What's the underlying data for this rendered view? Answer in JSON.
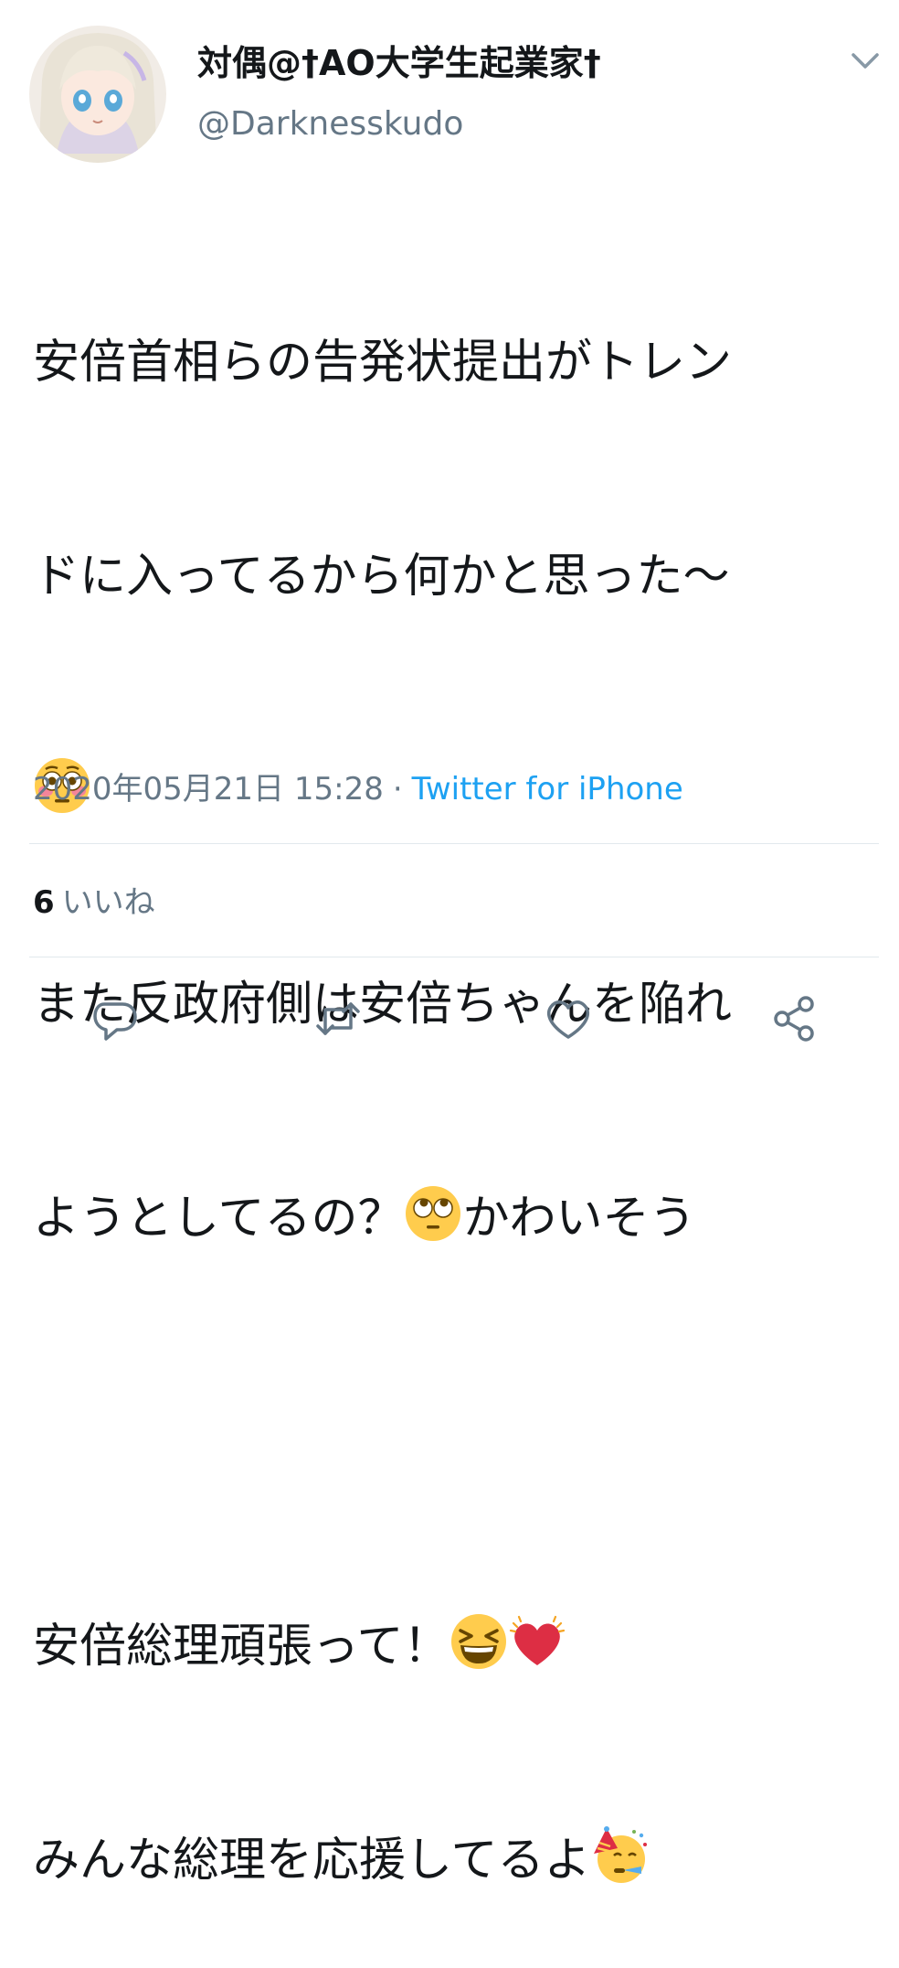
{
  "tweet": {
    "author": {
      "display_name": "対偶@†AO大学生起業家†",
      "handle": "@Darknesskudo"
    },
    "lines": [
      "安倍首相らの告発状提出がトレン",
      "ドに入ってるから何かと思った〜",
      "また反政府側は安倍ちゃんを陥れ",
      "ようとしてるの？",
      "かわいそう",
      "安倍総理頑張って！",
      "みんな総理を応援してるよ"
    ],
    "emojis": {
      "flushed": "flushed-face",
      "eye_roll": "face-with-rolling-eyes",
      "laughing": "grinning-squinting-face",
      "heart": "beating-heart",
      "party": "partying-face"
    },
    "timestamp": "2020年05月21日 15:28",
    "separator": "·",
    "source": "Twitter for iPhone",
    "likes": {
      "count": "6",
      "label": "いいね"
    }
  },
  "actions": {
    "reply": "reply-icon",
    "retweet": "retweet-icon",
    "like": "heart-icon",
    "share": "share-icon"
  },
  "colors": {
    "text": "#14171a",
    "secondary": "#657786",
    "accent": "#1da1f2",
    "divider": "#e1e8ed"
  }
}
